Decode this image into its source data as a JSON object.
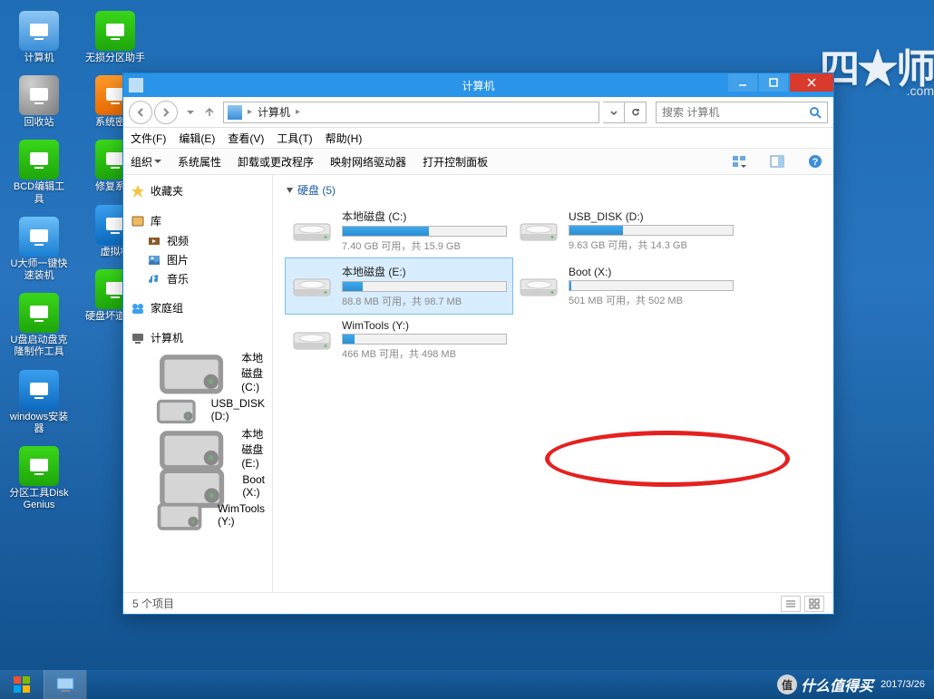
{
  "desktop_icons": [
    {
      "name": "computer",
      "label": "计算机",
      "cls": "ic-comp"
    },
    {
      "name": "partition-assist",
      "label": "无损分区助手",
      "cls": "ic-green"
    },
    {
      "name": "recycle-bin",
      "label": "回收站",
      "cls": "ic-rb"
    },
    {
      "name": "system-pwd",
      "label": "系统密码",
      "cls": "ic-orange"
    },
    {
      "name": "bcd-editor",
      "label": "BCD编辑工具",
      "cls": "ic-green"
    },
    {
      "name": "repair-sys",
      "label": "修复系统",
      "cls": "ic-green"
    },
    {
      "name": "u-install",
      "label": "U大师一键快速装机",
      "cls": "ic-ghost"
    },
    {
      "name": "virtual",
      "label": "虚拟机",
      "cls": "ic-blue"
    },
    {
      "name": "u-boot",
      "label": "U盘启动盘克隆制作工具",
      "cls": "ic-green"
    },
    {
      "name": "hdd-bad",
      "label": "硬盘坏道工具",
      "cls": "ic-green"
    },
    {
      "name": "win-install",
      "label": "windows安装器",
      "cls": "ic-win"
    },
    {
      "name": "diskgenius",
      "label": "分区工具DiskGenius",
      "cls": "ic-green"
    }
  ],
  "logo_back": "四★师",
  "logo_sub": ".com",
  "window": {
    "title": "计算机",
    "address": {
      "location": "计算机",
      "sep": "▸"
    },
    "search_placeholder": "搜索 计算机",
    "menubar": [
      "文件(F)",
      "编辑(E)",
      "查看(V)",
      "工具(T)",
      "帮助(H)"
    ],
    "toolbar": [
      "组织",
      "系统属性",
      "卸载或更改程序",
      "映射网络驱动器",
      "打开控制面板"
    ],
    "sidebar": {
      "fav": {
        "head": "收藏夹"
      },
      "lib": {
        "head": "库",
        "items": [
          "视频",
          "图片",
          "音乐"
        ]
      },
      "hg": {
        "head": "家庭组"
      },
      "comp": {
        "head": "计算机",
        "items": [
          "本地磁盘 (C:)",
          "USB_DISK (D:)",
          "本地磁盘 (E:)",
          "Boot (X:)",
          "WimTools (Y:)"
        ]
      }
    },
    "section_head": "硬盘 (5)",
    "drives": [
      {
        "name": "本地磁盘 (C:)",
        "free": "7.40 GB 可用，共 15.9 GB",
        "pct": 53
      },
      {
        "name": "USB_DISK (D:)",
        "free": "9.63 GB 可用，共 14.3 GB",
        "pct": 33
      },
      {
        "name": "本地磁盘 (E:)",
        "free": "88.8 MB 可用，共 98.7 MB",
        "pct": 12,
        "selected": true
      },
      {
        "name": "Boot (X:)",
        "free": "501 MB 可用，共 502 MB",
        "pct": 1
      },
      {
        "name": "WimTools (Y:)",
        "free": "466 MB 可用，共 498 MB",
        "pct": 7
      }
    ],
    "status": "5 个项目"
  },
  "taskbar": {
    "smzdm_badge": "值",
    "smzdm_text": "什么值得买",
    "date": "2017/3/26"
  },
  "colors": {
    "accent": "#2a94e8",
    "close": "#d93a2b",
    "annot": "#e62020"
  }
}
